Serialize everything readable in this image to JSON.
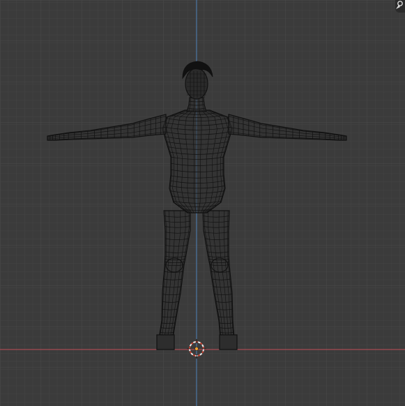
{
  "viewport": {
    "background": "#3b3b3b",
    "grid_minor_color": "#444444",
    "grid_major_color": "#4c4c4c",
    "x_axis_color": "#c24c57",
    "z_axis_color": "#4b7fb7",
    "mesh_color": "#111111",
    "cursor_color": "#e05a3a",
    "origin_color": "#f0a030"
  },
  "objects": [
    {
      "name": "Human body",
      "mode": "wireframe"
    }
  ],
  "overlay": {
    "gizmo_icon": "view-navigation-icon"
  }
}
